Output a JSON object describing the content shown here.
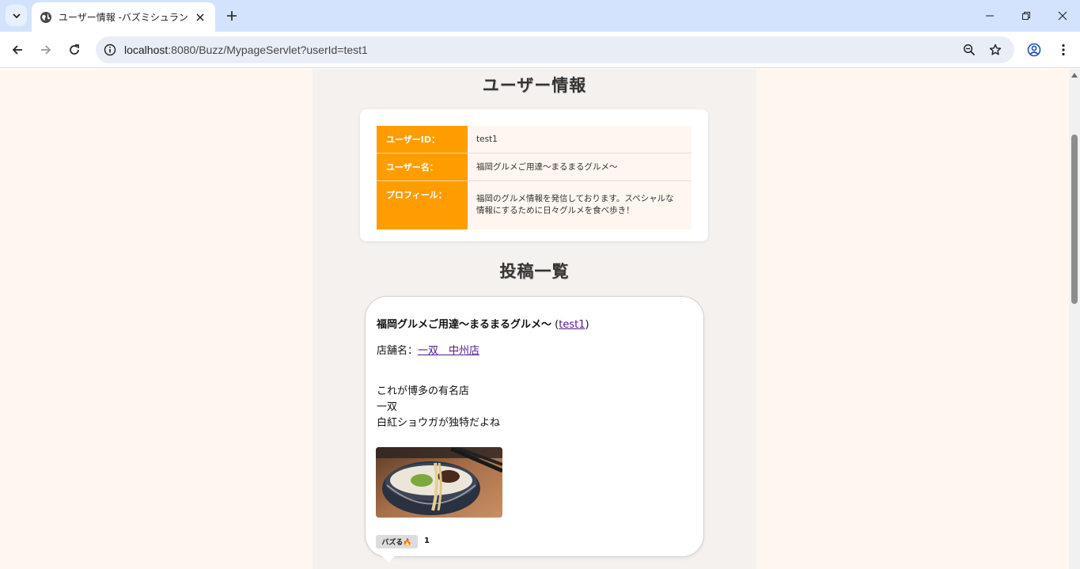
{
  "browser": {
    "tab_title": "ユーザー情報 -バズミシュラン",
    "url_host": "localhost",
    "url_path": ":8080/Buzz/MypageServlet?userId=test1"
  },
  "profile": {
    "heading": "ユーザー情報",
    "user_id_label": "ユーザーID：",
    "user_id_value": "test1",
    "user_name_label": "ユーザー名：",
    "user_name_value": "福岡グルメご用達〜まるまるグルメ〜",
    "profile_label": "プロフィール：",
    "profile_value": "福岡のグルメ情報を発信しております。スペシャルな情報にするために日々グルメを食べ歩き！"
  },
  "posts": {
    "heading": "投稿一覧",
    "items": [
      {
        "author_name": "福岡グルメご用達〜まるまるグルメ〜",
        "paren_open": " (",
        "author_id": "test1",
        "paren_close": ")",
        "shop_label": "店舗名：",
        "shop_name": "一双　中州店",
        "body_lines": [
          "これが博多の有名店",
          "一双",
          "白紅ショウガが独特だよね"
        ],
        "buzz_label": "バズる🔥",
        "buzz_count": "1"
      }
    ]
  },
  "icons": {
    "tab_favicon": "globe-icon",
    "site_info": "info-icon",
    "zoom": "zoom-out-icon",
    "bookmark": "star-icon",
    "profile": "account-circle-icon",
    "menu": "kebab-menu-icon"
  },
  "colors": {
    "accent_orange": "#ff9d00",
    "page_bg": "#fff6ef",
    "column_bg": "#f4f1ee",
    "link_visited": "#551a8b"
  }
}
